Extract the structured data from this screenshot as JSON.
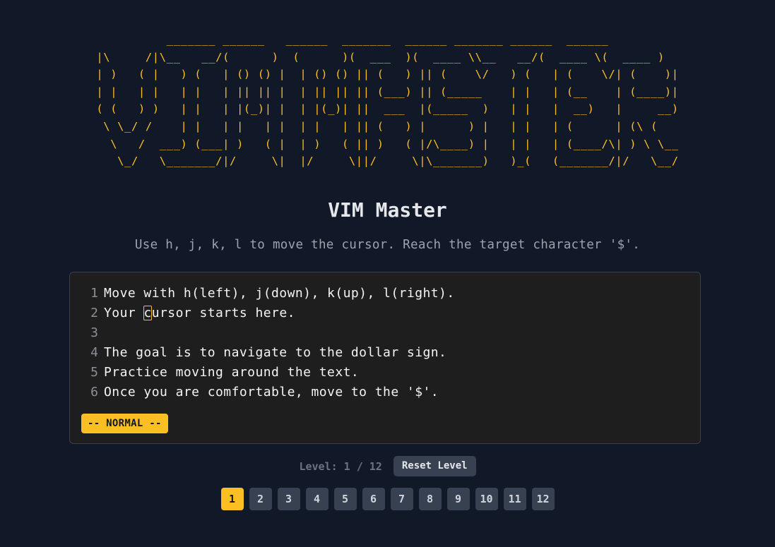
{
  "logo": {
    "ascii": "          _______ ______   ______  _______  ______ _______ ______  ______\n|\\     /|\\__   __/(      )  (      )(  ___  )(  ____ \\\\__   __/(  ____ \\(  ____ )\n| )   ( |   ) (   | () () |  | () () || (   ) || (    \\/   ) (   | (    \\/| (    )|\n| |   | |   | |   | || || |  | || || || (___) || (_____    | |   | (__    | (____)|\n( (   ) )   | |   | |(_)| |  | |(_)| ||  ___  |(_____  )   | |   |  __)   |     __)\n \\ \\_/ /    | |   | |   | |  | |   | || (   ) |      ) |   | |   | (      | (\\ (\n  \\   /  ___) (___| )   ( |  | )   ( || )   ( |/\\____) |   | |   | (____/\\| ) \\ \\__\n   \\_/   \\_______/|/     \\|  |/     \\||/     \\|\\_______)   )_(   (_______/|/   \\__/"
  },
  "title": "VIM Master",
  "instructions": "Use h, j, k, l to move the cursor. Reach the target character '$'.",
  "editor": {
    "lines": [
      {
        "number": "1",
        "text": "Move with h(left), j(down), k(up), l(right)."
      },
      {
        "number": "2",
        "before": "Your ",
        "cursor": "c",
        "after": "ursor starts here."
      },
      {
        "number": "3",
        "text": ""
      },
      {
        "number": "4",
        "text": "The goal is to navigate to the dollar sign."
      },
      {
        "number": "5",
        "text": "Practice moving around the text."
      },
      {
        "number": "6",
        "text": "Once you are comfortable, move to the '$'."
      }
    ],
    "mode": "-- NORMAL --"
  },
  "level": {
    "label": "Level: 1 / 12",
    "current": 1,
    "total": 12,
    "reset_label": "Reset Level",
    "buttons": [
      "1",
      "2",
      "3",
      "4",
      "5",
      "6",
      "7",
      "8",
      "9",
      "10",
      "11",
      "12"
    ]
  },
  "colors": {
    "background": "#111827",
    "accent": "#fbbf24",
    "editor_bg": "#1e1e1e",
    "button_bg": "#374151"
  }
}
